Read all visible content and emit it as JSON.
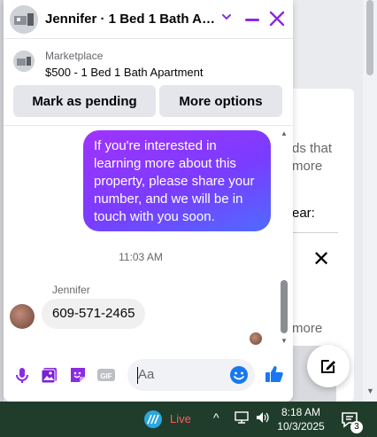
{
  "chat": {
    "title": "Jennifer · 1 Bed 1 Bath Apa...",
    "listing": {
      "label": "Marketplace",
      "price_title": "$500 - 1 Bed 1 Bath Apartment",
      "buttons": {
        "pending": "Mark as pending",
        "more": "More options"
      }
    },
    "messages": {
      "outgoing": "If you're interested in learning more about this property, please share your number, and we will be in touch with you soon.",
      "timestamp": "11:03 AM",
      "sender": "Jennifer",
      "incoming": "609-571-2465"
    },
    "composer": {
      "placeholder": "Aa"
    },
    "accent": "#8a2be2"
  },
  "background": {
    "e": "e",
    "line1": "ds that",
    "line2": "more",
    "line3": "ear:",
    "more_link": "more"
  },
  "taskbar": {
    "live_label": "Live",
    "time": "8:18 AM",
    "date": "10/3/2025",
    "notifications": "3"
  }
}
